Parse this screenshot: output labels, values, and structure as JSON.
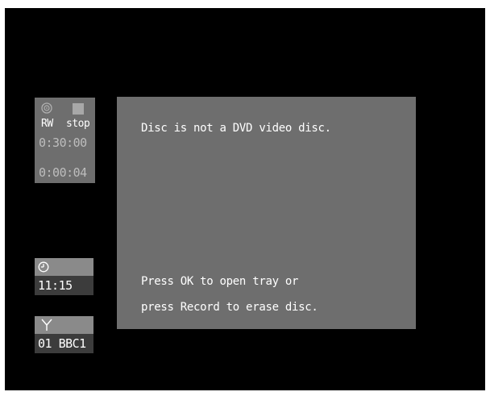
{
  "disc_status": {
    "disc_type": "RW",
    "play_state": "stop",
    "total_time": "0:30:00",
    "elapsed_time": "0:00:04",
    "disc_icon": "disc-icon",
    "state_icon": "stop-icon"
  },
  "clock": {
    "icon": "clock-icon",
    "time": "11:15"
  },
  "channel": {
    "icon": "antenna-icon",
    "name": "01 BBC1"
  },
  "message": {
    "title": "Disc is not a DVD video disc.",
    "instruction_line1": "Press OK to open tray or",
    "instruction_line2": "press Record to erase disc."
  },
  "colors": {
    "screen_background": "#000000",
    "panel": "#6e6e6e",
    "panel_light": "#8a8a8a",
    "panel_dark": "#3c3c3c",
    "text": "#ffffff"
  }
}
